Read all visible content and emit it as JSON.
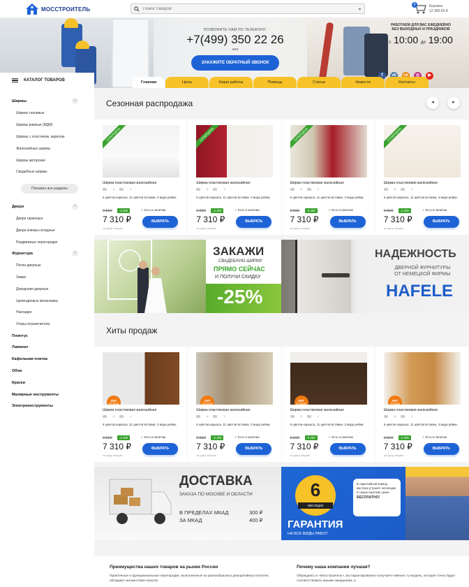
{
  "header": {
    "logo": "МОССТРОИТЕЛЬ",
    "search_placeholder": "Поиск товаров",
    "cart_label": "Корзина",
    "cart_count": "0",
    "cart_sum": "12 960.00 ₽"
  },
  "hero": {
    "call_text": "ПОЗВОНИТЕ НАМ ПО ТЕЛЕФОНУ:",
    "phone": "+7(499) 350 22 26",
    "or": "или",
    "callback_button": "ЗАКАЖИТЕ ОБРАТНЫЙ ЗВОНОК",
    "hours_title_1": "РАБОТАЕМ ДЛЯ ВАС ЕЖЕДНЕВНО",
    "hours_title_2": "БЕЗ ВЫХОДНЫХ И ПРАЗДНИКОВ",
    "hours_from_prefix": "с",
    "hours_from": "10:00",
    "hours_to_prefix": "до",
    "hours_to": "19:00",
    "socials": [
      {
        "name": "facebook-icon",
        "glyph": "f",
        "color": "#3b5998"
      },
      {
        "name": "vk-icon",
        "glyph": "vk",
        "color": "#4a76a8"
      },
      {
        "name": "ok-icon",
        "glyph": "ok",
        "color": "#ee8208"
      },
      {
        "name": "instagram-icon",
        "glyph": "◎",
        "color": "#c13584"
      },
      {
        "name": "youtube-icon",
        "glyph": "▶",
        "color": "#e02a20"
      }
    ]
  },
  "catalog_label": "КАТАЛОГ ТОВАРОВ",
  "nav_tabs": [
    "Главная",
    "Цены",
    "Наши работы",
    "Помощь",
    "Статьи",
    "Новости",
    "Контакты"
  ],
  "sidebar": {
    "group1": "Ширмы",
    "group1_items": [
      "Ширмы тканевые",
      "Ширмы рамные (МДФ)",
      "Ширмы с пластиком, акрилом",
      "Жалюзийные ширмы",
      "Ширмы авторские",
      "Свадебные ширмы"
    ],
    "show_all": "Показать все разделы",
    "group2": "Двери",
    "group2_items": [
      "Двери гармошка",
      "Двери книжка складные",
      "Раздвижные перегородки"
    ],
    "group3": "Фурнитура",
    "group3_items": [
      "Петли дверные",
      "Замки",
      "Доводчики дверные",
      "Цилиндровые механизмы",
      "Накладки",
      "Упоры-ограничители"
    ],
    "plain": [
      "Плинтус",
      "Ламинат",
      "Кафельная плитка",
      "Обои",
      "Краски",
      "Малярные инструменты",
      "Электроинструменты"
    ]
  },
  "section1": {
    "title": "Сезонная распродажа",
    "ribbon": "СУПЕРЦЕНА",
    "card": {
      "name": "Ширма пластиковая жалюзийная",
      "views": "6",
      "comments": "1",
      "desc": "6 цветов каркаса, 11 цветов вставки, 3 вида рейки,",
      "old_price": "9 500",
      "discount": "-2 200",
      "stock": "Есть в наличии",
      "price": "7 310 ₽",
      "sub": "за одну секцию",
      "buy": "ВЫБРАТЬ"
    }
  },
  "banner_screens": {
    "t1": "ЗАКАЖИ",
    "t2": "СВАДЕБНУЮ ШИРМУ",
    "t3": "ПРЯМО СЕЙЧАС",
    "t4": "И ПОЛУЧИ СКИДКУ",
    "t5": "-25%"
  },
  "banner_hafele": {
    "t1": "НАДЕЖНОСТЬ",
    "t2a": "ДВЕРНОЙ ФУРНИТУРЫ",
    "t2b": "ОТ НЕМЕЦКОЙ ФИРМЫ",
    "t3": "HAFELE"
  },
  "section2": {
    "title": "Хиты продаж",
    "hit": "ХИТ",
    "hit_sub": "ПРОДАЖ",
    "card": {
      "name": "Ширма пластиковая жалюзийная",
      "views": "6",
      "comments": "1",
      "desc": "6 цветов каркаса, 11 цветов вставки, 3 вида рейки,",
      "old_price": "9 500",
      "discount": "-2 200",
      "stock": "Есть в наличии",
      "price": "7 310 ₽",
      "sub": "за одну секцию",
      "buy": "ВЫБРАТЬ"
    }
  },
  "banner_delivery": {
    "t1": "ДОСТАВКА",
    "t2": "ЗАКАЗА ПО МОСКВЕ И ОБЛАСТИ",
    "l1": "В ПРЕДЕЛАХ МКАД",
    "l2": "ЗА МКАД",
    "p1": "300 ₽",
    "p2": "400 ₽"
  },
  "banner_warranty": {
    "num": "6",
    "months": "МЕСЯЦЕВ",
    "bubble": "В гарантийный период мастера устранят неполадки в самые короткие сроки",
    "bubble_bold": "БЕСПЛАТНО!",
    "t1": "ГАРАНТИЯ",
    "t2": "НА ВСЕ ВИДЫ РАБОТ"
  },
  "footer": {
    "h1": "Преимущества наших товаров на рынке России",
    "p1": "Практичные и функциональные перегородки, выполненные из разнообразных декоративных полотен, обладают множеством плюсов:",
    "h2": "Почему наша компания лучшая?",
    "p2": "Обращаясь в «Мосстроитель», вы гарантированно получаете именно ту модель, которая точно будет соответствовать вашим ожиданиям, а"
  }
}
